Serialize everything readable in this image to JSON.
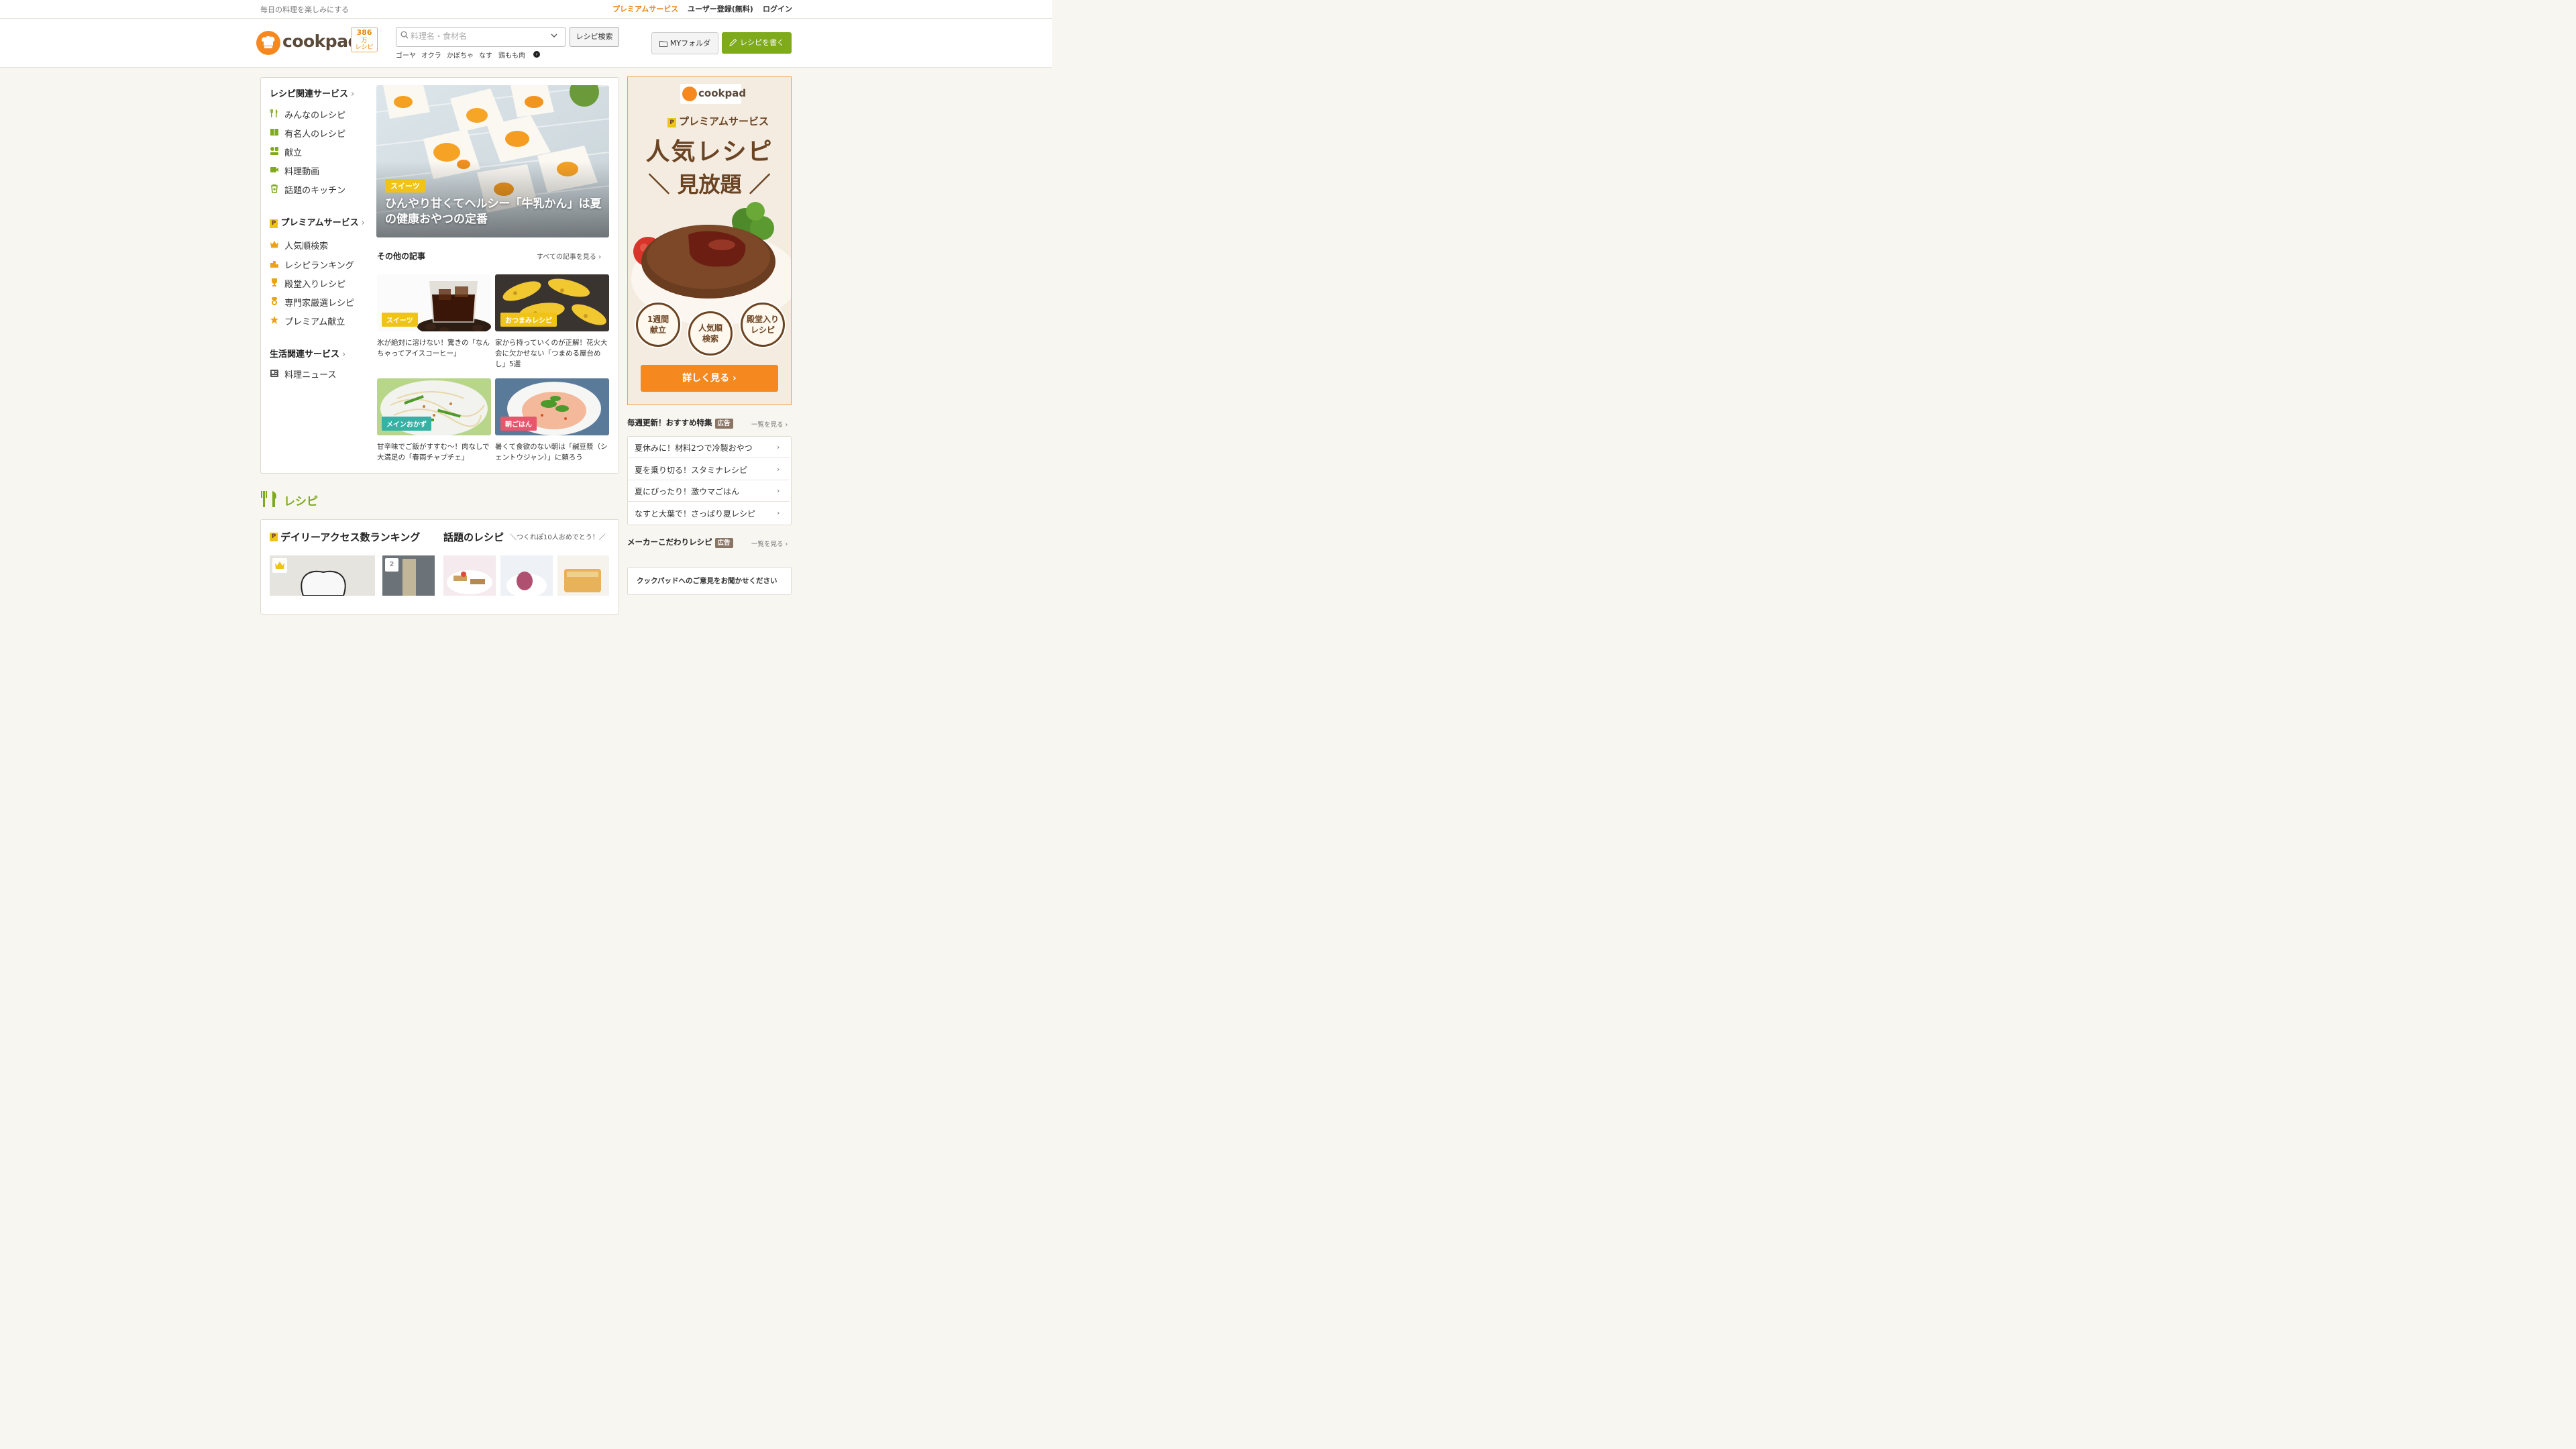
{
  "topbar": {
    "tagline": "毎日の料理を楽しみにする",
    "premium_link": "プレミアムサービス",
    "register_link": "ユーザー登録(無料)",
    "login_link": "ログイン"
  },
  "header": {
    "logo_text": "cookpad",
    "recipe_count": {
      "number": "386",
      "unit": "万",
      "label": "レシピ"
    },
    "search_placeholder": "料理名・食材名",
    "search_button": "レシピ検索",
    "keywords": [
      "ゴーヤ",
      "オクラ",
      "かぼちゃ",
      "なす",
      "鶏もも肉"
    ],
    "my_folder": "MYフォルダ",
    "write_recipe": "レシピを書く"
  },
  "nav": {
    "recipe_services": {
      "title": "レシピ関連サービス",
      "items": [
        {
          "label": "みんなのレシピ",
          "icon": "fork-knife-icon"
        },
        {
          "label": "有名人のレシピ",
          "icon": "book-icon"
        },
        {
          "label": "献立",
          "icon": "menu-plate-icon"
        },
        {
          "label": "料理動画",
          "icon": "video-icon"
        },
        {
          "label": "話題のキッチン",
          "icon": "kitchen-icon"
        }
      ]
    },
    "premium_services": {
      "title": "プレミアムサービス",
      "items": [
        {
          "label": "人気順検索",
          "icon": "crown-icon"
        },
        {
          "label": "レシピランキング",
          "icon": "ranking-icon"
        },
        {
          "label": "殿堂入りレシピ",
          "icon": "trophy-icon"
        },
        {
          "label": "専門家厳選レシピ",
          "icon": "expert-icon"
        },
        {
          "label": "プレミアム献立",
          "icon": "premium-menu-icon"
        }
      ]
    },
    "life_services": {
      "title": "生活関連サービス",
      "items": [
        {
          "label": "料理ニュース",
          "icon": "news-icon"
        }
      ]
    }
  },
  "hero": {
    "tag": "スイーツ",
    "title": "ひんやり甘くてヘルシー「牛乳かん」は夏の健康おやつの定番"
  },
  "articles": {
    "title": "その他の記事",
    "all_link": "すべての記事を見る",
    "items": [
      {
        "tag": "スイーツ",
        "tag_color": "#f0c417",
        "text": "氷が絶対に溶けない！驚きの「なんちゃってアイスコーヒー」"
      },
      {
        "tag": "おつまみレシピ",
        "tag_color": "#f0c417",
        "text": "家から持っていくのが正解！花火大会に欠かせない「つまめる屋台めし」5選"
      },
      {
        "tag": "メインおかず",
        "tag_color": "#35b2a3",
        "text": "甘辛味でご飯がすすむ〜！肉なしで大満足の「春雨チャプチェ」"
      },
      {
        "tag": "朝ごはん",
        "tag_color": "#e8566e",
        "text": "暑くて食欲のない朝は「鹹豆漿（シェントウジャン）」に頼ろう"
      }
    ]
  },
  "recipe_section": {
    "title": "レシピ",
    "daily_ranking": "デイリーアクセス数ランキング",
    "trending": "話題のレシピ",
    "trending_sub": "＼つくれぽ10人おめでとう！／",
    "rank_badges": [
      "1",
      "2"
    ]
  },
  "premium_ad": {
    "logo": "cookpad",
    "premium_title": "プレミアムサービス",
    "headline_1": "人気レシピ",
    "headline_2": "＼ 見放題 ／",
    "bubbles": [
      "1週間\n献立",
      "人気順\n検索",
      "殿堂入り\nレシピ"
    ],
    "cta": "詳しく見る"
  },
  "weekly": {
    "title": "毎週更新！おすすめ特集",
    "ad_label": "広告",
    "more": "一覧を見る",
    "items": [
      "夏休みに！材料2つで冷製おやつ",
      "夏を乗り切る！スタミナレシピ",
      "夏にぴったり！激ウマごはん",
      "なすと大葉で！さっぱり夏レシピ"
    ]
  },
  "maker": {
    "title": "メーカーこだわりレシピ",
    "ad_label": "広告",
    "more": "一覧を見る"
  },
  "feedback": {
    "text": "クックパッドへのご意見をお聞かせください"
  },
  "colors": {
    "brand_orange": "#f5891f",
    "brand_green": "#7eaa1c",
    "premium_brown": "#6b4423"
  }
}
